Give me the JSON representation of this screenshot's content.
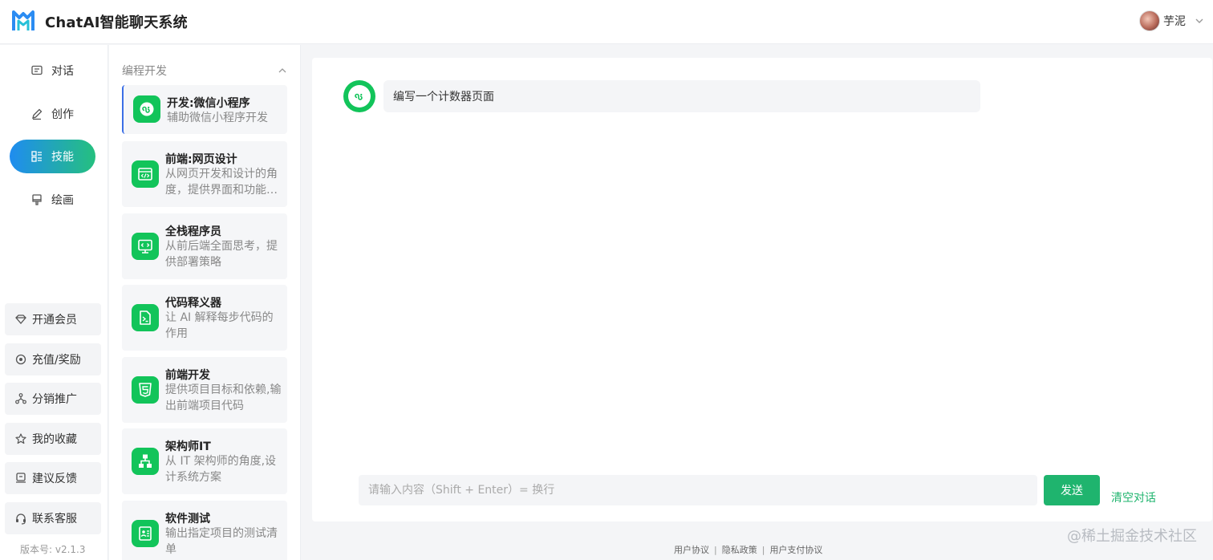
{
  "header": {
    "app_title": "ChatAI智能聊天系统",
    "user_name": "芋泥"
  },
  "nav": {
    "items": [
      {
        "label": "对话",
        "icon": "chat-icon"
      },
      {
        "label": "创作",
        "icon": "pen-icon"
      },
      {
        "label": "技能",
        "icon": "skills-icon",
        "active": true
      },
      {
        "label": "绘画",
        "icon": "brush-icon"
      }
    ],
    "side_buttons": [
      {
        "label": "开通会员",
        "icon": "diamond-icon"
      },
      {
        "label": "充值/奖励",
        "icon": "coin-icon"
      },
      {
        "label": "分销推广",
        "icon": "share-icon"
      },
      {
        "label": "我的收藏",
        "icon": "star-icon"
      },
      {
        "label": "建议反馈",
        "icon": "feedback-icon"
      },
      {
        "label": "联系客服",
        "icon": "headset-icon"
      }
    ],
    "version": "版本号: v2.1.3"
  },
  "skills": {
    "category": "编程开发",
    "items": [
      {
        "title": "开发:微信小程序",
        "desc": "辅助微信小程序开发",
        "icon": "mini-program-icon"
      },
      {
        "title": "前端:网页设计",
        "desc": "从网页开发和设计的角度，提供界面和功能…",
        "icon": "web-code-icon"
      },
      {
        "title": "全栈程序员",
        "desc": "从前后端全面思考，提供部署策略",
        "icon": "monitor-code-icon"
      },
      {
        "title": "代码释义器",
        "desc": "让 AI 解释每步代码的作用",
        "icon": "terminal-file-icon"
      },
      {
        "title": "前端开发",
        "desc": "提供项目目标和依赖,输出前端项目代码",
        "icon": "html5-icon"
      },
      {
        "title": "架构师IT",
        "desc": "从 IT 架构师的角度,设计系统方案",
        "icon": "architecture-icon"
      },
      {
        "title": "软件测试",
        "desc": "输出指定项目的测试清单",
        "icon": "test-checklist-icon"
      }
    ]
  },
  "chat": {
    "message": "编写一个计数器页面",
    "input_placeholder": "请输入内容（Shift + Enter）= 换行",
    "send_label": "发送",
    "clear_label": "清空对话"
  },
  "footer": {
    "links": [
      "用户协议",
      "隐私政策",
      "用户支付协议"
    ],
    "separator": "|"
  },
  "watermark": "@稀土掘金技术社区",
  "colors": {
    "accent_green": "#1fb46e",
    "icon_green": "#12c45a",
    "nav_gradient_start": "#1f8cf0",
    "nav_gradient_end": "#25c07f"
  }
}
